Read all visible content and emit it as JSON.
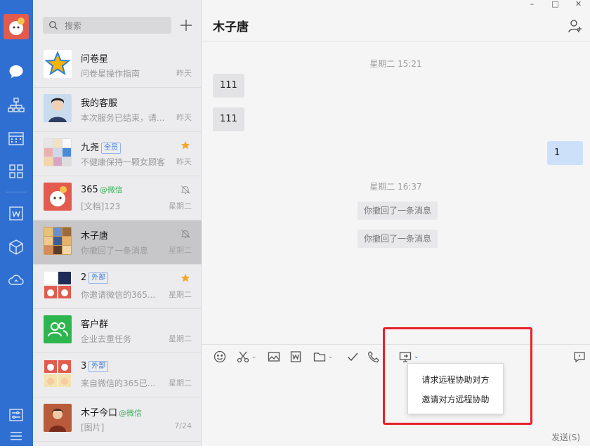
{
  "sidebar": {
    "icons": [
      "chat-icon",
      "org-tree-icon",
      "calendar-icon",
      "apps-grid-icon",
      "doc-w-icon",
      "cube-icon",
      "cloud-icon",
      "settings-sliders-icon",
      "menu-icon"
    ]
  },
  "search": {
    "placeholder": "搜索"
  },
  "conversations": [
    {
      "name": "问卷星",
      "snippet": "问卷星操作指南",
      "time": "昨天"
    },
    {
      "name": "我的客服",
      "snippet": "本次服务已结束，请...",
      "time": "昨天"
    },
    {
      "name": "九尧",
      "tag": "全员",
      "snippet": "不健康保持一颗女顾客",
      "time": "昨天",
      "starred": true
    },
    {
      "name": "365",
      "wechat": "@微信",
      "snippet": "[文档]123",
      "time": "星期二",
      "muted": true
    },
    {
      "name": "木子唐",
      "snippet": "你撤回了一条消息",
      "time": "星期二",
      "muted": true,
      "selected": true
    },
    {
      "name": "2",
      "tag": "外部",
      "snippet": "你邀请微信的365...",
      "time": "星期二",
      "starred": true
    },
    {
      "name": "客户群",
      "snippet": "企业去重任务",
      "time": "星期二"
    },
    {
      "name": "3",
      "tag": "外部",
      "snippet": "来自微信的365已...",
      "time": "星期二"
    },
    {
      "name": "木子今口",
      "wechat": "@微信",
      "snippet": "[图片]",
      "time": "7/24"
    }
  ],
  "chat": {
    "title": "木子唐",
    "window_buttons": [
      "–",
      "□",
      "✕"
    ],
    "time1": "星期二 15:21",
    "msg1": "111",
    "msg2": "111",
    "msg3": "1",
    "time2": "星期二 16:37",
    "sys1": "你撤回了一条消息",
    "sys2": "你撤回了一条消息",
    "send": "发送(S)"
  },
  "remote_menu": {
    "item1": "请求远程协助对方",
    "item2": "邀请对方远程协助"
  },
  "colors": {
    "sidebar": "#2f6fd2",
    "highlight": "#e8212a",
    "bubble_out": "#cde0fa",
    "wechat_green": "#3bb15b"
  }
}
